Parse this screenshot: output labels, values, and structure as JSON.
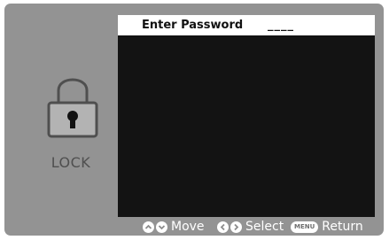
{
  "lock": {
    "icon": "padlock-icon",
    "label": "LOCK"
  },
  "password_row": {
    "label": "Enter Password",
    "value": "____"
  },
  "hints": {
    "move": "Move",
    "select": "Select",
    "menu_key": "MENU",
    "return": "Return"
  },
  "colors": {
    "frame": "#939393",
    "menu_background": "#131313",
    "selected_row": "#ffffff",
    "icon": "#4f4f4f"
  }
}
